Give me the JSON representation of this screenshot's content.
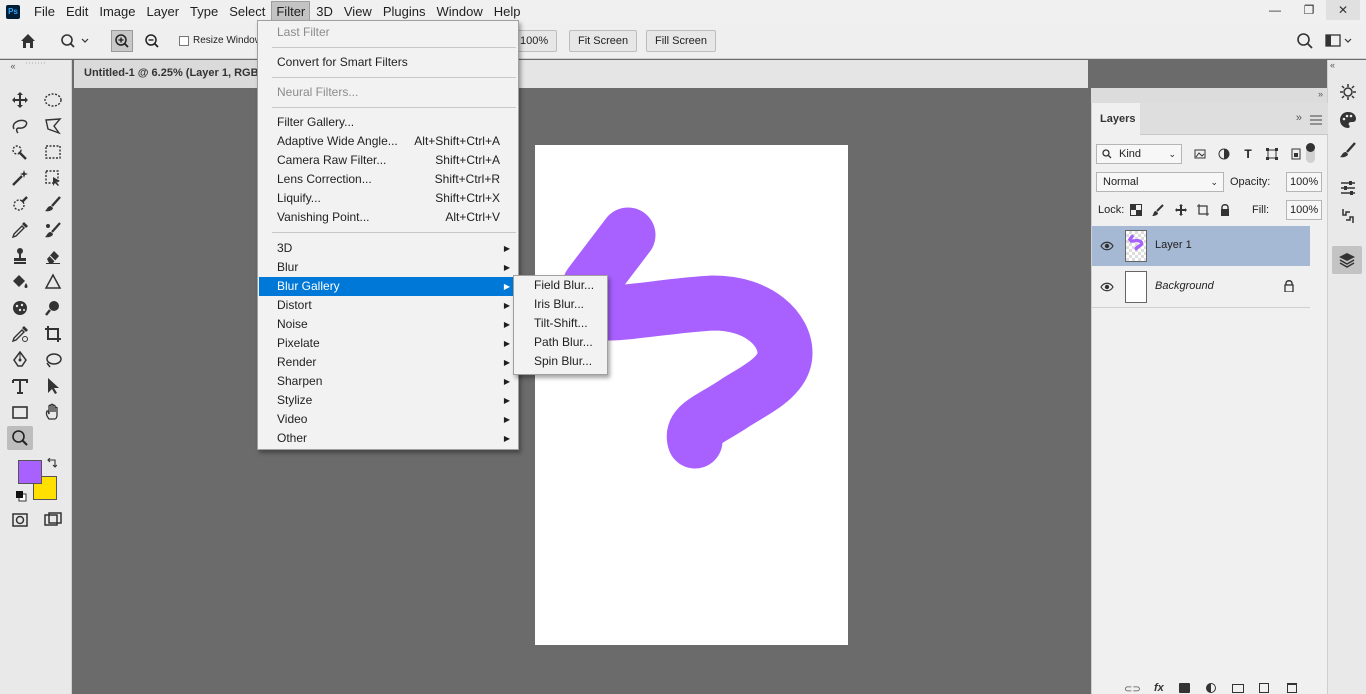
{
  "app": {
    "logo": "Ps",
    "menus": [
      "File",
      "Edit",
      "Image",
      "Layer",
      "Type",
      "Select",
      "Filter",
      "3D",
      "View",
      "Plugins",
      "Window",
      "Help"
    ],
    "active_menu": "Filter",
    "window_controls": [
      "—",
      "❐",
      "✕"
    ]
  },
  "options_bar": {
    "resize_windows_label": "Resize Window",
    "zoom_100_label": "100%",
    "fit_screen_label": "Fit Screen",
    "fill_screen_label": "Fill Screen"
  },
  "document": {
    "tab_title": "Untitled-1 @ 6.25% (Layer 1, RGB"
  },
  "filter_menu": {
    "last_filter": "Last Filter",
    "convert_smart": "Convert for Smart Filters",
    "neural_filters": "Neural Filters...",
    "filter_gallery": "Filter Gallery...",
    "adaptive_wide_angle": "Adaptive Wide Angle...",
    "adaptive_wide_angle_sc": "Alt+Shift+Ctrl+A",
    "camera_raw": "Camera Raw Filter...",
    "camera_raw_sc": "Shift+Ctrl+A",
    "lens_correction": "Lens Correction...",
    "lens_correction_sc": "Shift+Ctrl+R",
    "liquify": "Liquify...",
    "liquify_sc": "Shift+Ctrl+X",
    "vanishing_point": "Vanishing Point...",
    "vanishing_point_sc": "Alt+Ctrl+V",
    "submenus": [
      "3D",
      "Blur",
      "Blur Gallery",
      "Distort",
      "Noise",
      "Pixelate",
      "Render",
      "Sharpen",
      "Stylize",
      "Video",
      "Other"
    ],
    "highlighted": "Blur Gallery"
  },
  "blur_gallery_submenu": [
    "Field Blur...",
    "Iris Blur...",
    "Tilt-Shift...",
    "Path Blur...",
    "Spin Blur..."
  ],
  "layers_panel": {
    "tab_label": "Layers",
    "kind_label": "Kind",
    "blend_mode": "Normal",
    "opacity_label": "Opacity:",
    "opacity_value": "100%",
    "lock_label": "Lock:",
    "fill_label": "Fill:",
    "fill_value": "100%",
    "layers": [
      {
        "name": "Layer 1",
        "selected": true
      },
      {
        "name": "Background",
        "selected": false,
        "locked": true
      }
    ]
  },
  "colors": {
    "foreground": "#a860ff",
    "background": "#ffe000",
    "stroke": "#a860ff",
    "menu_highlight": "#0078d7"
  }
}
